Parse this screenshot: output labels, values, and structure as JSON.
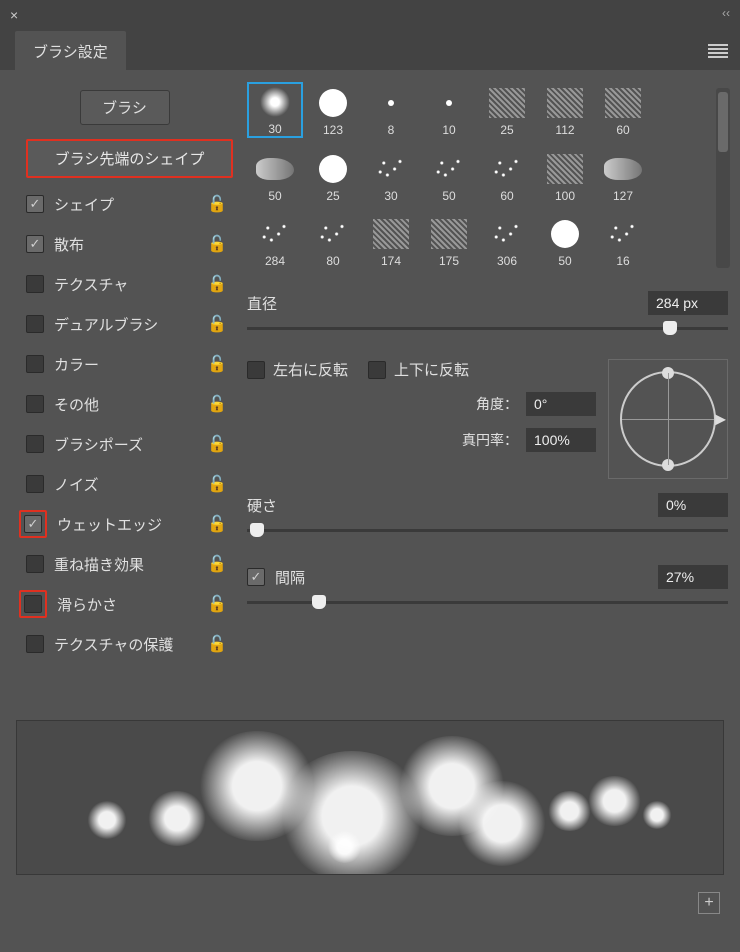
{
  "panel": {
    "title": "ブラシ設定"
  },
  "left": {
    "brush_btn": "ブラシ",
    "tip_shape": "ブラシ先端のシェイプ",
    "options": [
      {
        "label": "シェイプ",
        "checked": true,
        "highlight": false
      },
      {
        "label": "散布",
        "checked": true,
        "highlight": false
      },
      {
        "label": "テクスチャ",
        "checked": false,
        "highlight": false
      },
      {
        "label": "デュアルブラシ",
        "checked": false,
        "highlight": false
      },
      {
        "label": "カラー",
        "checked": false,
        "highlight": false
      },
      {
        "label": "その他",
        "checked": false,
        "highlight": false
      },
      {
        "label": "ブラシポーズ",
        "checked": false,
        "highlight": false
      },
      {
        "label": "ノイズ",
        "checked": false,
        "highlight": false
      },
      {
        "label": "ウェットエッジ",
        "checked": true,
        "highlight": true
      },
      {
        "label": "重ね描き効果",
        "checked": false,
        "highlight": false
      },
      {
        "label": "滑らかさ",
        "checked": false,
        "highlight": true
      },
      {
        "label": "テクスチャの保護",
        "checked": false,
        "highlight": false
      }
    ]
  },
  "brushes": [
    {
      "size": "30",
      "type": "soft",
      "selected": true
    },
    {
      "size": "123",
      "type": "hard"
    },
    {
      "size": "8",
      "type": "dot"
    },
    {
      "size": "10",
      "type": "dot"
    },
    {
      "size": "25",
      "type": "tex"
    },
    {
      "size": "112",
      "type": "tex"
    },
    {
      "size": "60",
      "type": "tex"
    },
    {
      "size": "50",
      "type": "smear"
    },
    {
      "size": "25",
      "type": "hard"
    },
    {
      "size": "30",
      "type": "spray"
    },
    {
      "size": "50",
      "type": "spray"
    },
    {
      "size": "60",
      "type": "spray"
    },
    {
      "size": "100",
      "type": "tex"
    },
    {
      "size": "127",
      "type": "smear"
    },
    {
      "size": "284",
      "type": "spray"
    },
    {
      "size": "80",
      "type": "spray"
    },
    {
      "size": "174",
      "type": "tex"
    },
    {
      "size": "175",
      "type": "tex"
    },
    {
      "size": "306",
      "type": "spray"
    },
    {
      "size": "50",
      "type": "hard"
    },
    {
      "size": "16",
      "type": "spray"
    }
  ],
  "controls": {
    "diameter_label": "直径",
    "diameter_value": "284 px",
    "diameter_pct": 88,
    "flipx_label": "左右に反転",
    "flipy_label": "上下に反転",
    "flipx": false,
    "flipy": false,
    "angle_label": "角度：",
    "angle_value": "0°",
    "round_label": "真円率：",
    "round_value": "100%",
    "hardness_label": "硬さ",
    "hardness_value": "0%",
    "hardness_pct": 2,
    "spacing_on": true,
    "spacing_label": "間隔",
    "spacing_value": "27%",
    "spacing_pct": 15
  },
  "icons": {
    "check": "✓",
    "lock": "🔓",
    "plus": "+"
  }
}
